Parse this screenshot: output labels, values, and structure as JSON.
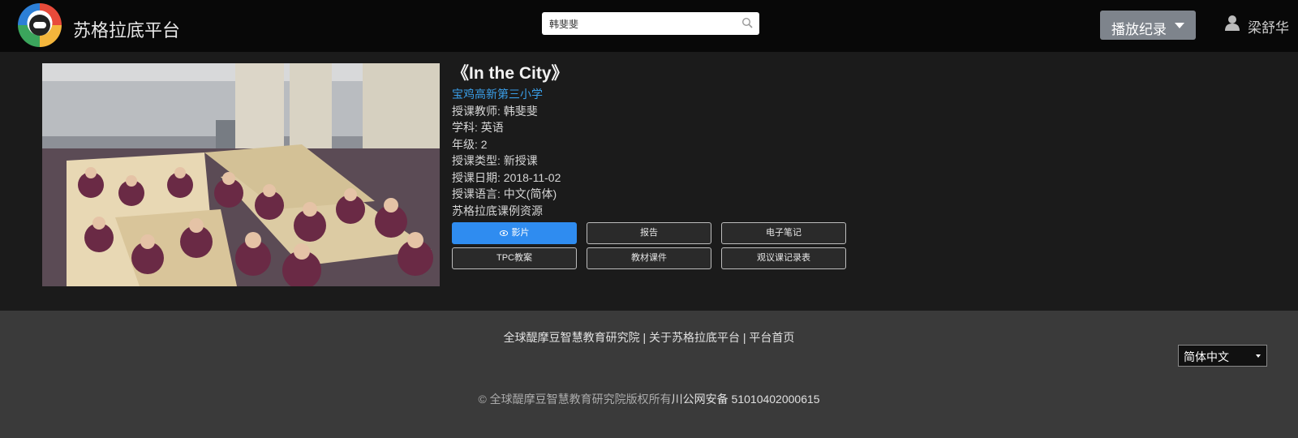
{
  "header": {
    "app_title": "苏格拉底平台",
    "search_value": "韩斐斐",
    "history_button": "播放纪录",
    "user_name": "梁舒华"
  },
  "lesson": {
    "title": "《In the City》",
    "school": "宝鸡高新第三小学",
    "teacher": "授课教师: 韩斐斐",
    "subject": "学科: 英语",
    "grade": "年级: 2",
    "lesson_type": "授课类型: 新授课",
    "date": "授课日期: 2018-11-02",
    "language": "授课语言: 中文(简体)",
    "resource": "苏格拉底课例资源"
  },
  "buttons": {
    "video": "影片",
    "report": "报告",
    "notes": "电子笔记",
    "tpc": "TPC教案",
    "materials": "教材课件",
    "observation": "观议课记录表"
  },
  "footer": {
    "links": "全球醍摩豆智慧教育研究院 | 关于苏格拉底平台 | 平台首页",
    "language": "简体中文",
    "copyright": "© 全球醍摩豆智慧教育研究院版权所有",
    "police_record": "川公网安备 51010402000615"
  },
  "colors": {
    "accent_blue": "#2f8cf0",
    "link_blue": "#3a9ee8",
    "header_bg": "#080808",
    "content_bg": "#1b1b1b",
    "footer_bg": "#3a3a3a"
  }
}
